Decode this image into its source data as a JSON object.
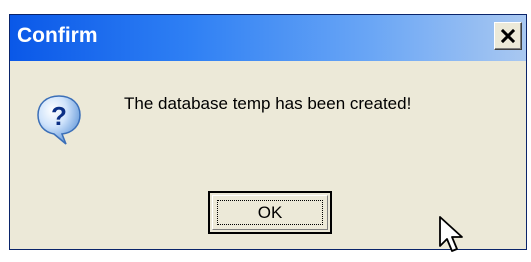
{
  "window": {
    "title": "Confirm",
    "close_icon": "close-icon"
  },
  "dialog": {
    "icon": "question-icon",
    "message": "The database temp has been created!",
    "ok_label": "OK"
  },
  "colors": {
    "titlebar_start": "#0a58e8",
    "titlebar_end": "#a9c8f1",
    "dialog_bg": "#ece9d8"
  }
}
